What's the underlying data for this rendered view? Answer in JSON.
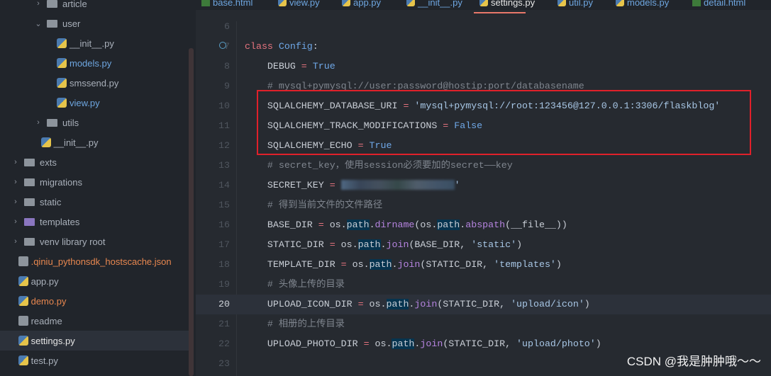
{
  "tabs": [
    {
      "label": "base.html",
      "icon": "html-file-icon"
    },
    {
      "label": "view.py",
      "icon": "python-file-icon"
    },
    {
      "label": "app.py",
      "icon": "python-file-icon"
    },
    {
      "label": "__init__.py",
      "icon": "python-file-icon"
    },
    {
      "label": "settings.py",
      "icon": "python-file-icon",
      "active": true
    },
    {
      "label": "util.py",
      "icon": "python-file-icon"
    },
    {
      "label": "models.py",
      "icon": "python-file-icon"
    },
    {
      "label": "detail.html",
      "icon": "html-file-icon"
    }
  ],
  "tree": [
    {
      "label": "article",
      "type": "folder",
      "indent": 1,
      "chev": ">",
      "color": "#a9b0ba"
    },
    {
      "label": "user",
      "type": "folder",
      "indent": 1,
      "chev": "v",
      "color": "#a9b0ba"
    },
    {
      "label": "__init__.py",
      "type": "py",
      "indent": 2,
      "color": "#a9b0ba"
    },
    {
      "label": "models.py",
      "type": "py",
      "indent": 2,
      "color": "#6ea6e0"
    },
    {
      "label": "smssend.py",
      "type": "py",
      "indent": 2,
      "color": "#a9b0ba"
    },
    {
      "label": "view.py",
      "type": "py",
      "indent": 2,
      "color": "#6ea6e0"
    },
    {
      "label": "utils",
      "type": "folder",
      "indent": 1,
      "chev": ">",
      "color": "#a9b0ba"
    },
    {
      "label": "__init__.py",
      "type": "py",
      "indent": 1.3,
      "color": "#a9b0ba"
    },
    {
      "label": "exts",
      "type": "folder",
      "indent": 0,
      "chev": ">",
      "color": "#a9b0ba"
    },
    {
      "label": "migrations",
      "type": "folder",
      "indent": 0,
      "chev": ">",
      "color": "#a9b0ba"
    },
    {
      "label": "static",
      "type": "folder",
      "indent": 0,
      "chev": ">",
      "color": "#a9b0ba"
    },
    {
      "label": "templates",
      "type": "folder-purple",
      "indent": 0,
      "chev": ">",
      "color": "#a9b0ba"
    },
    {
      "label": "venv  library root",
      "type": "folder",
      "indent": 0,
      "chev": ">",
      "color": "#a9b0ba"
    },
    {
      "label": ".qiniu_pythonsdk_hostscache.json",
      "type": "doc",
      "indent": 0.3,
      "color": "#e8874f"
    },
    {
      "label": "app.py",
      "type": "py",
      "indent": 0.3,
      "color": "#a9b0ba"
    },
    {
      "label": "demo.py",
      "type": "py",
      "indent": 0.3,
      "color": "#e8874f"
    },
    {
      "label": "readme",
      "type": "doc",
      "indent": 0.3,
      "color": "#a9b0ba"
    },
    {
      "label": "settings.py",
      "type": "py",
      "indent": 0.3,
      "color": "#e6e6e6",
      "selected": true
    },
    {
      "label": "test.py",
      "type": "py",
      "indent": 0.3,
      "color": "#a9b0ba"
    }
  ],
  "code": [
    {
      "n": "6",
      "tokens": []
    },
    {
      "n": "7",
      "tokens": [
        [
          "kw",
          "class"
        ],
        [
          "",
          ""
        ],
        [
          "cls",
          " Config"
        ],
        [
          "",
          ":"
        ]
      ]
    },
    {
      "n": "8",
      "tokens": [
        [
          "",
          "    DEBUG "
        ],
        [
          "op",
          "="
        ],
        [
          "bool",
          " True"
        ]
      ]
    },
    {
      "n": "9",
      "tokens": [
        [
          "cm",
          "    # mysql+pymysql://user:password@hostip:port/databasename"
        ]
      ]
    },
    {
      "n": "10",
      "tokens": [
        [
          "",
          "    SQLALCHEMY_DATABASE_URI "
        ],
        [
          "op",
          "="
        ],
        [
          "str",
          " 'mysql+pymysql://root:123456@127.0.0.1:3306/flaskblog'"
        ]
      ]
    },
    {
      "n": "11",
      "tokens": [
        [
          "",
          "    SQLALCHEMY_TRACK_MODIFICATIONS "
        ],
        [
          "op",
          "="
        ],
        [
          "bool",
          " False"
        ]
      ]
    },
    {
      "n": "12",
      "tokens": [
        [
          "",
          "    SQLALCHEMY_ECHO "
        ],
        [
          "op",
          "="
        ],
        [
          "bool",
          " True"
        ]
      ]
    },
    {
      "n": "13",
      "tokens": [
        [
          "cm",
          "    # secret_key，使用session必须要加的secret——key"
        ]
      ]
    },
    {
      "n": "14",
      "tokens": [
        [
          "",
          "    SECRET_KEY "
        ],
        [
          "op",
          "="
        ],
        [
          "",
          " "
        ],
        [
          "blur",
          ""
        ],
        [
          "str",
          "'"
        ]
      ]
    },
    {
      "n": "15",
      "tokens": [
        [
          "cm",
          "    # 得到当前文件的文件路径"
        ]
      ]
    },
    {
      "n": "16",
      "tokens": [
        [
          "",
          "    BASE_DIR "
        ],
        [
          "op",
          "="
        ],
        [
          "",
          " os."
        ],
        [
          "hl",
          "path"
        ],
        [
          "",
          "."
        ],
        [
          "fn",
          "dirname"
        ],
        [
          "",
          "(os."
        ],
        [
          "hl",
          "path"
        ],
        [
          "",
          "."
        ],
        [
          "fn",
          "abspath"
        ],
        [
          "",
          "(__file__))"
        ]
      ]
    },
    {
      "n": "17",
      "tokens": [
        [
          "",
          "    STATIC_DIR "
        ],
        [
          "op",
          "="
        ],
        [
          "",
          " os."
        ],
        [
          "hl",
          "path"
        ],
        [
          "",
          "."
        ],
        [
          "fn",
          "join"
        ],
        [
          "",
          "(BASE_DIR, "
        ],
        [
          "str",
          "'static'"
        ],
        [
          "",
          ")"
        ]
      ]
    },
    {
      "n": "18",
      "tokens": [
        [
          "",
          "    TEMPLATE_DIR "
        ],
        [
          "op",
          "="
        ],
        [
          "",
          " os."
        ],
        [
          "hl",
          "path"
        ],
        [
          "",
          "."
        ],
        [
          "fn",
          "join"
        ],
        [
          "",
          "(STATIC_DIR, "
        ],
        [
          "str",
          "'templates'"
        ],
        [
          "",
          ")"
        ]
      ]
    },
    {
      "n": "19",
      "tokens": [
        [
          "cm",
          "    # 头像上传的目录"
        ]
      ]
    },
    {
      "n": "20",
      "current": true,
      "tokens": [
        [
          "",
          "    UPLOAD_ICON_DIR "
        ],
        [
          "op",
          "="
        ],
        [
          "",
          " os."
        ],
        [
          "hl",
          "path"
        ],
        [
          "",
          "."
        ],
        [
          "fn",
          "join"
        ],
        [
          "",
          "(STATIC_DIR, "
        ],
        [
          "str",
          "'upload/icon'"
        ],
        [
          "",
          ")"
        ]
      ]
    },
    {
      "n": "21",
      "tokens": [
        [
          "cm",
          "    # 相册的上传目录"
        ]
      ]
    },
    {
      "n": "22",
      "tokens": [
        [
          "",
          "    UPLOAD_PHOTO_DIR "
        ],
        [
          "op",
          "="
        ],
        [
          "",
          " os."
        ],
        [
          "hl",
          "path"
        ],
        [
          "",
          "."
        ],
        [
          "fn",
          "join"
        ],
        [
          "",
          "(STATIC_DIR, "
        ],
        [
          "str",
          "'upload/photo'"
        ],
        [
          "",
          ")"
        ]
      ]
    },
    {
      "n": "23",
      "tokens": []
    }
  ],
  "watermark": "CSDN @我是肿肿哦～～"
}
